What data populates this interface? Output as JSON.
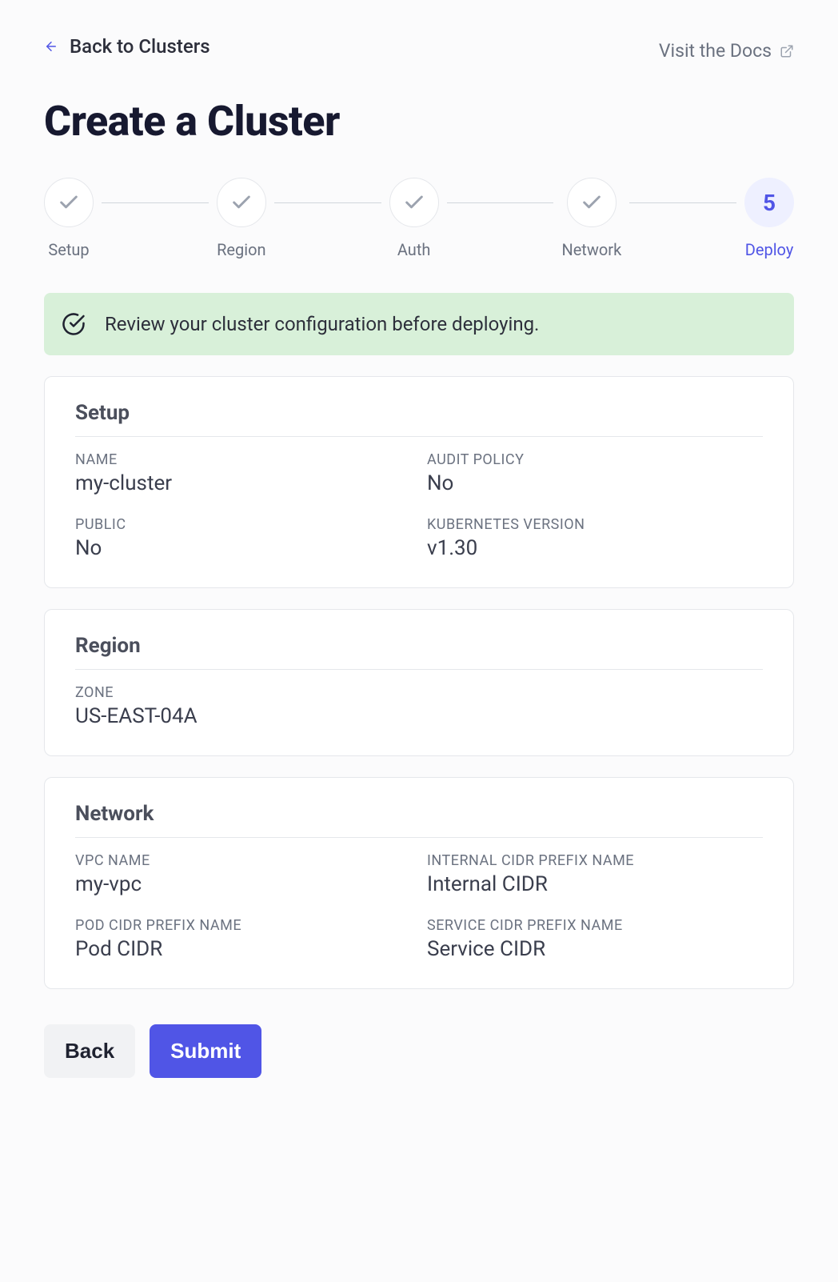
{
  "header": {
    "back_label": "Back to Clusters",
    "docs_label": "Visit the Docs"
  },
  "page_title": "Create a Cluster",
  "stepper": {
    "steps": [
      {
        "label": "Setup",
        "state": "done"
      },
      {
        "label": "Region",
        "state": "done"
      },
      {
        "label": "Auth",
        "state": "done"
      },
      {
        "label": "Network",
        "state": "done"
      },
      {
        "label": "Deploy",
        "state": "current",
        "number": "5"
      }
    ]
  },
  "alert": {
    "text": "Review your cluster configuration before deploying."
  },
  "summary": {
    "setup": {
      "title": "Setup",
      "fields": {
        "name": {
          "label": "NAME",
          "value": "my-cluster"
        },
        "audit_policy": {
          "label": "AUDIT POLICY",
          "value": "No"
        },
        "public": {
          "label": "PUBLIC",
          "value": "No"
        },
        "kubernetes_version": {
          "label": "KUBERNETES VERSION",
          "value": "v1.30"
        }
      }
    },
    "region": {
      "title": "Region",
      "fields": {
        "zone": {
          "label": "ZONE",
          "value": "US-EAST-04A"
        }
      }
    },
    "network": {
      "title": "Network",
      "fields": {
        "vpc_name": {
          "label": "VPC NAME",
          "value": "my-vpc"
        },
        "internal_cidr_prefix": {
          "label": "INTERNAL CIDR PREFIX NAME",
          "value": "Internal CIDR"
        },
        "pod_cidr_prefix": {
          "label": "POD CIDR PREFIX NAME",
          "value": "Pod CIDR"
        },
        "service_cidr_prefix": {
          "label": "SERVICE CIDR PREFIX NAME",
          "value": "Service CIDR"
        }
      }
    }
  },
  "actions": {
    "back": "Back",
    "submit": "Submit"
  }
}
